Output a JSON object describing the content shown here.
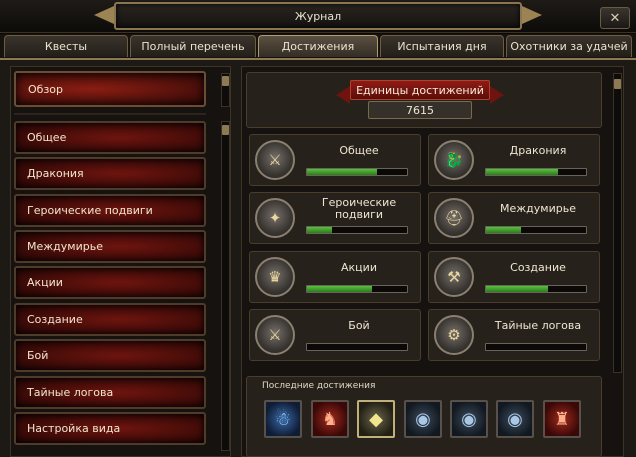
{
  "window": {
    "title": "Журнал",
    "close_symbol": "✕"
  },
  "tabs": [
    {
      "label": "Квесты",
      "active": false
    },
    {
      "label": "Полный перечень",
      "active": false
    },
    {
      "label": "Достижения",
      "active": true
    },
    {
      "label": "Испытания дня",
      "active": false
    },
    {
      "label": "Охотники за удачей",
      "active": false
    }
  ],
  "sidebar": {
    "overview": "Обзор",
    "items": [
      {
        "label": "Общее"
      },
      {
        "label": "Дракония"
      },
      {
        "label": "Героические подвиги"
      },
      {
        "label": "Междумирье"
      },
      {
        "label": "Акции"
      },
      {
        "label": "Создание"
      },
      {
        "label": "Бой"
      },
      {
        "label": "Тайные логова"
      },
      {
        "label": "Настройка вида"
      }
    ]
  },
  "summary": {
    "title": "Единицы достижений",
    "value": "7615"
  },
  "categories": [
    {
      "label": "Общее",
      "progress": 0.7,
      "icon": "crossed-sword-shield-icon"
    },
    {
      "label": "Дракония",
      "progress": 0.72,
      "icon": "dragon-head-icon"
    },
    {
      "label": "Героические подвиги",
      "progress": 0.25,
      "icon": "heroic-star-icon"
    },
    {
      "label": "Междумирье",
      "progress": 0.35,
      "icon": "winged-helmet-icon"
    },
    {
      "label": "Акции",
      "progress": 0.65,
      "icon": "crown-emblem-icon"
    },
    {
      "label": "Создание",
      "progress": 0.62,
      "icon": "crossed-hammers-icon"
    },
    {
      "label": "Бой",
      "progress": 0.0,
      "icon": "crossed-swords-icon"
    },
    {
      "label": "Тайные логова",
      "progress": 0.0,
      "icon": "gear-skull-icon"
    }
  ],
  "recent": {
    "title": "Последние достижения",
    "items": [
      {
        "icon": "blue-spirit-icon",
        "style": "blue"
      },
      {
        "icon": "red-warrior-icon",
        "style": "red"
      },
      {
        "icon": "gold-gem-icon",
        "style": "gold"
      },
      {
        "icon": "eye-orb-icon",
        "style": "steel"
      },
      {
        "icon": "eye-orb-icon",
        "style": "steel"
      },
      {
        "icon": "eye-orb-icon",
        "style": "steel"
      },
      {
        "icon": "red-demon-icon",
        "style": "red"
      }
    ]
  }
}
